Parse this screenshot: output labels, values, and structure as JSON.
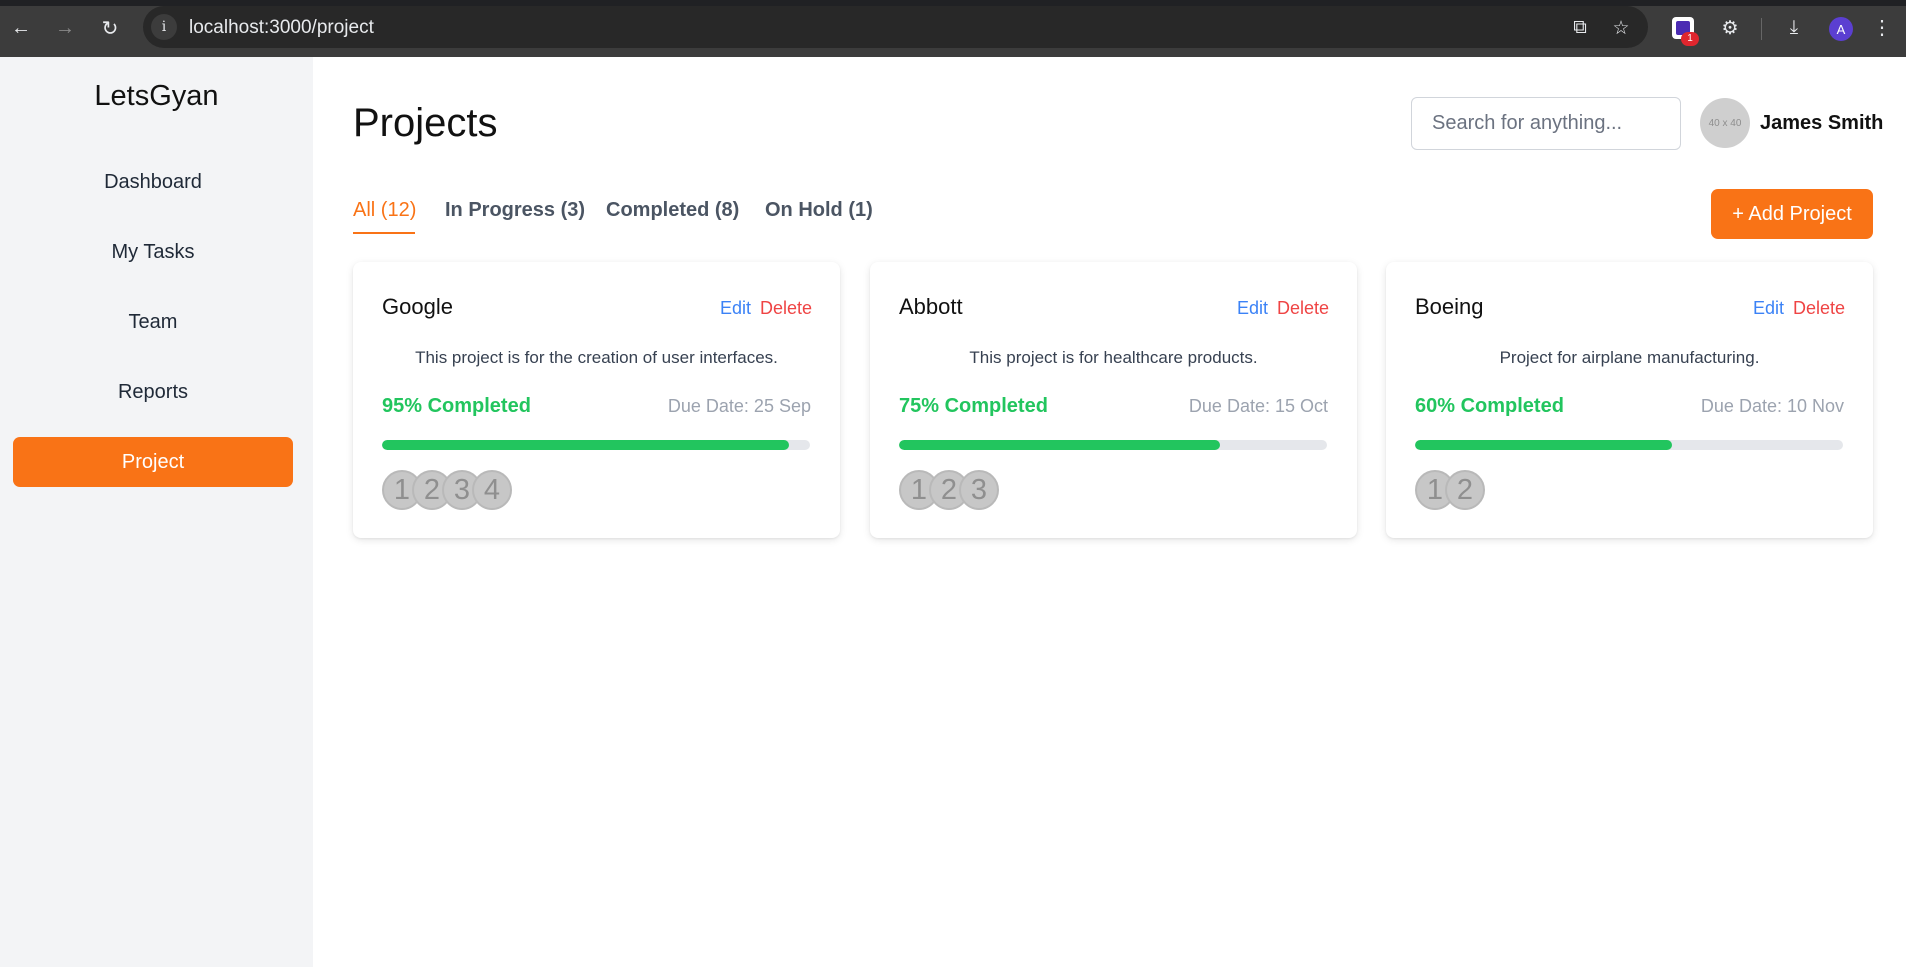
{
  "browser": {
    "url": "localhost:3000/project",
    "extension_badge": "1",
    "profile_initial": "A"
  },
  "sidebar": {
    "brand": "LetsGyan",
    "items": [
      {
        "label": "Dashboard",
        "active": false
      },
      {
        "label": "My Tasks",
        "active": false
      },
      {
        "label": "Team",
        "active": false
      },
      {
        "label": "Reports",
        "active": false
      },
      {
        "label": "Project",
        "active": true
      }
    ]
  },
  "header": {
    "title": "Projects",
    "search_placeholder": "Search for anything...",
    "avatar_text": "40 x 40",
    "user_name": "James Smith"
  },
  "tabs": [
    {
      "label": "All (12)",
      "active": true
    },
    {
      "label": "In Progress (3)",
      "active": false
    },
    {
      "label": "Completed (8)",
      "active": false
    },
    {
      "label": "On Hold (1)",
      "active": false
    }
  ],
  "add_button_label": "+ Add Project",
  "projects": [
    {
      "name": "Google",
      "edit_label": "Edit",
      "delete_label": "Delete",
      "description": "This project is for the creation of user interfaces.",
      "completed_label": "95% Completed",
      "progress": 0.95,
      "due": "Due Date: 25 Sep",
      "members": [
        "1",
        "2",
        "3",
        "4"
      ]
    },
    {
      "name": "Abbott",
      "edit_label": "Edit",
      "delete_label": "Delete",
      "description": "This project is for healthcare products.",
      "completed_label": "75% Completed",
      "progress": 0.75,
      "due": "Due Date: 15 Oct",
      "members": [
        "1",
        "2",
        "3"
      ]
    },
    {
      "name": "Boeing",
      "edit_label": "Edit",
      "delete_label": "Delete",
      "description": "Project for airplane manufacturing.",
      "completed_label": "60% Completed",
      "progress": 0.6,
      "due": "Due Date: 10 Nov",
      "members": [
        "1",
        "2"
      ]
    }
  ],
  "colors": {
    "accent": "#f97316",
    "success": "#22c55e",
    "link": "#3b82f6",
    "danger": "#ef4444"
  }
}
